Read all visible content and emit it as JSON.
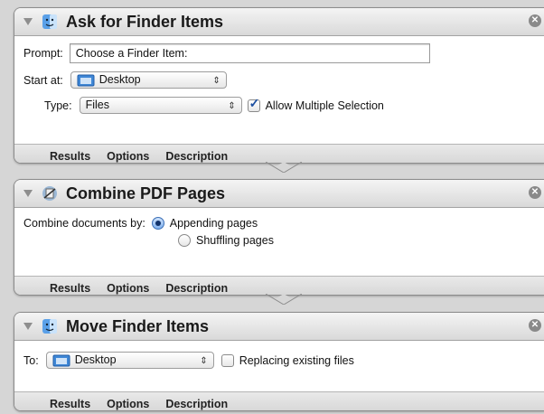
{
  "colors": {
    "background": "#d6d6d6",
    "accent": "#3b6fb6",
    "titlebar": "#e4e4e4"
  },
  "actions": [
    {
      "title": "Ask for Finder Items",
      "icon": "finder-icon",
      "prompt_label": "Prompt:",
      "prompt_value": "Choose a Finder Item:",
      "start_label": "Start at:",
      "start_value": "Desktop",
      "type_label": "Type:",
      "type_value": "Files",
      "allow_multiple_label": "Allow Multiple Selection",
      "allow_multiple_checked": true,
      "tabs": [
        "Results",
        "Options",
        "Description"
      ]
    },
    {
      "title": "Combine PDF Pages",
      "icon": "automator-icon",
      "combine_label": "Combine documents by:",
      "options": [
        {
          "label": "Appending pages",
          "selected": true
        },
        {
          "label": "Shuffling pages",
          "selected": false
        }
      ],
      "tabs": [
        "Results",
        "Options",
        "Description"
      ]
    },
    {
      "title": "Move Finder Items",
      "icon": "finder-icon",
      "to_label": "To:",
      "to_value": "Desktop",
      "replace_label": "Replacing existing files",
      "replace_checked": false,
      "tabs": [
        "Results",
        "Options",
        "Description"
      ]
    }
  ]
}
